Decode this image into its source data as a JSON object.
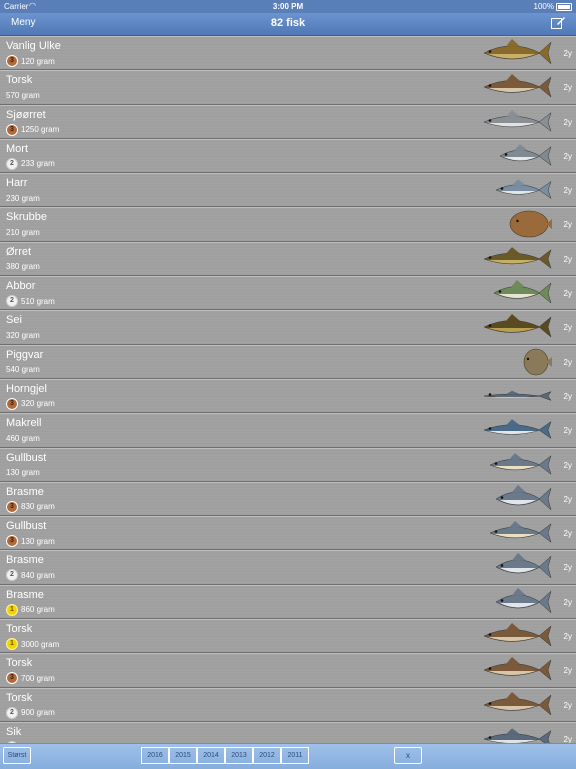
{
  "status": {
    "carrier": "Carrier",
    "time": "3:00 PM",
    "battery": "100%"
  },
  "nav": {
    "menu": "Meny",
    "title": "82 fisk"
  },
  "rows": [
    {
      "name": "Vanlig Ulke",
      "medal": "bronze",
      "weight": "120 gram",
      "age": "2y",
      "fish": "sculpin-fish-icon"
    },
    {
      "name": "Torsk",
      "medal": "",
      "weight": "570 gram",
      "age": "2y",
      "fish": "cod-fish-icon"
    },
    {
      "name": "Sjøørret",
      "medal": "bronze",
      "weight": "1250 gram",
      "age": "2y",
      "fish": "sea-trout-fish-icon"
    },
    {
      "name": "Mort",
      "medal": "silver",
      "weight": "233 gram",
      "age": "2y",
      "fish": "roach-fish-icon"
    },
    {
      "name": "Harr",
      "medal": "",
      "weight": "230 gram",
      "age": "2y",
      "fish": "grayling-fish-icon"
    },
    {
      "name": "Skrubbe",
      "medal": "",
      "weight": "210 gram",
      "age": "2y",
      "fish": "flounder-fish-icon"
    },
    {
      "name": "Ørret",
      "medal": "",
      "weight": "380 gram",
      "age": "2y",
      "fish": "trout-fish-icon"
    },
    {
      "name": "Abbor",
      "medal": "silver",
      "weight": "510 gram",
      "age": "2y",
      "fish": "perch-fish-icon"
    },
    {
      "name": "Sei",
      "medal": "",
      "weight": "320 gram",
      "age": "2y",
      "fish": "saithe-fish-icon"
    },
    {
      "name": "Piggvar",
      "medal": "",
      "weight": "540 gram",
      "age": "2y",
      "fish": "turbot-fish-icon"
    },
    {
      "name": "Horngjel",
      "medal": "bronze",
      "weight": "320 gram",
      "age": "2y",
      "fish": "garfish-fish-icon"
    },
    {
      "name": "Makrell",
      "medal": "",
      "weight": "460 gram",
      "age": "2y",
      "fish": "mackerel-fish-icon"
    },
    {
      "name": "Gullbust",
      "medal": "",
      "weight": "130 gram",
      "age": "2y",
      "fish": "rudd-fish-icon"
    },
    {
      "name": "Brasme",
      "medal": "bronze",
      "weight": "830 gram",
      "age": "2y",
      "fish": "bream-fish-icon"
    },
    {
      "name": "Gullbust",
      "medal": "bronze",
      "weight": "130 gram",
      "age": "2y",
      "fish": "rudd-fish-icon"
    },
    {
      "name": "Brasme",
      "medal": "silver",
      "weight": "840 gram",
      "age": "2y",
      "fish": "bream-fish-icon"
    },
    {
      "name": "Brasme",
      "medal": "gold",
      "weight": "860 gram",
      "age": "2y",
      "fish": "bream-fish-icon"
    },
    {
      "name": "Torsk",
      "medal": "gold",
      "weight": "3000 gram",
      "age": "2y",
      "fish": "cod-fish-icon"
    },
    {
      "name": "Torsk",
      "medal": "bronze",
      "weight": "700 gram",
      "age": "2y",
      "fish": "cod-fish-icon"
    },
    {
      "name": "Torsk",
      "medal": "silver",
      "weight": "900 gram",
      "age": "2y",
      "fish": "cod-fish-icon"
    },
    {
      "name": "Sik",
      "medal": "silver",
      "weight": "",
      "age": "2y",
      "fish": "whitefish-fish-icon"
    }
  ],
  "toolbar": {
    "largest": "Størst",
    "years": [
      "2016",
      "2015",
      "2014",
      "2013",
      "2012",
      "2011"
    ],
    "clear": "x"
  },
  "colors": {
    "nav": "#5a7fb8",
    "row": "#a0a0a0",
    "toolbar": "#9fc1ea"
  }
}
